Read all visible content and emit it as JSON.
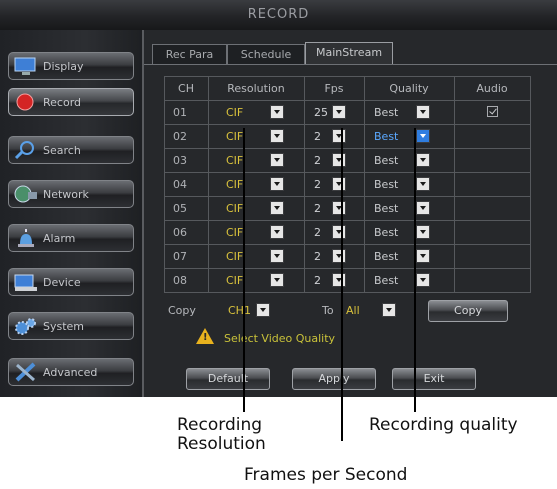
{
  "window": {
    "title": "RECORD"
  },
  "sidebar": {
    "items": [
      {
        "label": "Display",
        "icon": "monitor-icon"
      },
      {
        "label": "Record",
        "icon": "record-icon"
      },
      {
        "label": "Search",
        "icon": "magnifier-icon"
      },
      {
        "label": "Network",
        "icon": "network-globe-icon"
      },
      {
        "label": "Alarm",
        "icon": "alarm-light-icon"
      },
      {
        "label": "Device",
        "icon": "hard-drive-icon"
      },
      {
        "label": "System",
        "icon": "gears-icon"
      },
      {
        "label": "Advanced",
        "icon": "tools-icon"
      }
    ],
    "active": "Record"
  },
  "tabs": [
    {
      "label": "Rec Para"
    },
    {
      "label": "Schedule"
    },
    {
      "label": "MainStream"
    }
  ],
  "active_tab": "MainStream",
  "table": {
    "headers": [
      "CH",
      "Resolution",
      "Fps",
      "Quality",
      "Audio"
    ],
    "rows": [
      {
        "ch": "01",
        "resolution": "CIF",
        "fps": "25",
        "quality": "Best",
        "audio": true
      },
      {
        "ch": "02",
        "resolution": "CIF",
        "fps": "2",
        "quality": "Best",
        "audio": false
      },
      {
        "ch": "03",
        "resolution": "CIF",
        "fps": "2",
        "quality": "Best",
        "audio": false
      },
      {
        "ch": "04",
        "resolution": "CIF",
        "fps": "2",
        "quality": "Best",
        "audio": false
      },
      {
        "ch": "05",
        "resolution": "CIF",
        "fps": "2",
        "quality": "Best",
        "audio": false
      },
      {
        "ch": "06",
        "resolution": "CIF",
        "fps": "2",
        "quality": "Best",
        "audio": false
      },
      {
        "ch": "07",
        "resolution": "CIF",
        "fps": "2",
        "quality": "Best",
        "audio": false
      },
      {
        "ch": "08",
        "resolution": "CIF",
        "fps": "2",
        "quality": "Best",
        "audio": false
      }
    ]
  },
  "copy_row": {
    "copy_label": "Copy",
    "from_value": "CH1",
    "to_label": "To",
    "to_value": "All",
    "copy_button": "Copy"
  },
  "hint": "Select Video Quality",
  "buttons": {
    "default": "Default",
    "apply": "Apply",
    "exit": "Exit"
  },
  "annotations": {
    "resolution": "Recording Resolution",
    "fps": "Frames per Second",
    "quality": "Recording quality"
  },
  "colors": {
    "resolution_text": "#d9c23c",
    "selected_dropdown": "#2f7de0",
    "warning": "#e8b21e"
  }
}
